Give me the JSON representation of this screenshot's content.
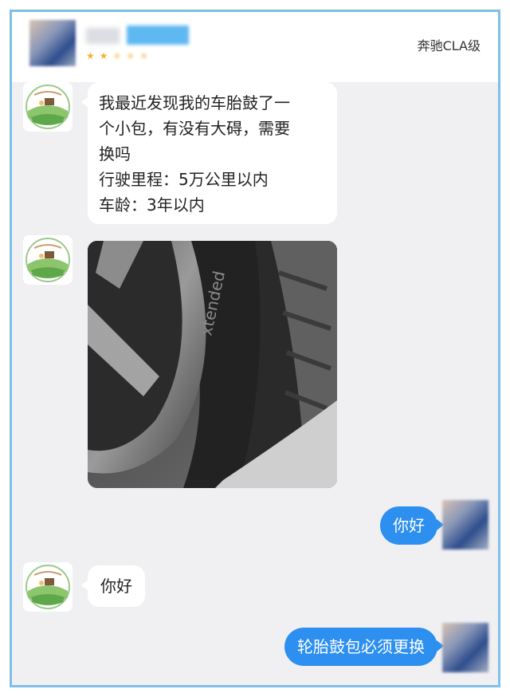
{
  "header": {
    "car_model": "奔驰CLA级",
    "stars": [
      "★",
      "★",
      "★",
      "★",
      "★"
    ]
  },
  "messages": [
    {
      "sender": "customer_service",
      "type": "text",
      "lines": [
        "我最近发现我的车胎鼓了一",
        "个小包，有没有大碍，需要",
        "换吗",
        "行驶里程：5万公里以内",
        "车龄：3年以内"
      ]
    },
    {
      "sender": "customer_service",
      "type": "image",
      "image_text": "xtended"
    },
    {
      "sender": "user",
      "type": "text",
      "text": "你好"
    },
    {
      "sender": "customer_service",
      "type": "text",
      "text": "你好"
    },
    {
      "sender": "user",
      "type": "text",
      "text": "轮胎鼓包必须更换"
    }
  ],
  "colors": {
    "frame_border": "#7fbfe8",
    "chat_background": "#f0f0f3",
    "user_bubble": "#2d8ff0",
    "agent_bubble": "#ffffff",
    "star": "#f2b233"
  }
}
